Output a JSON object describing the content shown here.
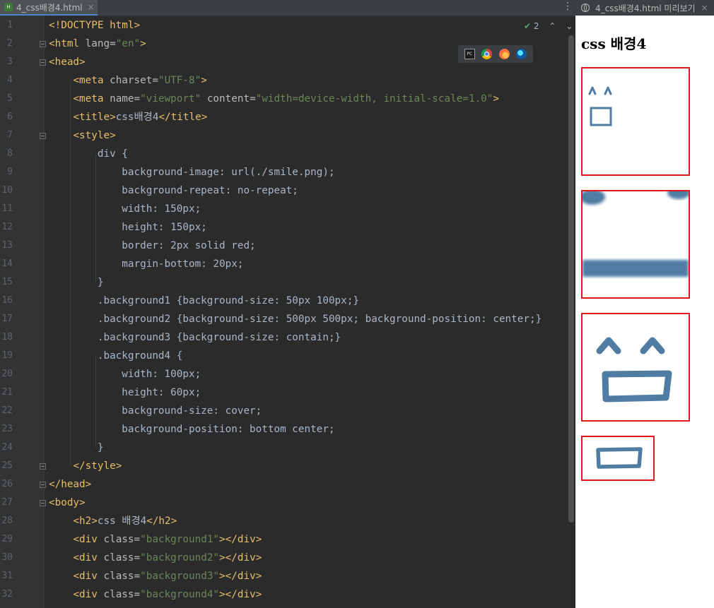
{
  "editor": {
    "tab_label": "4_css배경4.html",
    "tab_close": "×",
    "more_icon": "⋮",
    "inspection_count": "2",
    "check_icon": "check-icon",
    "browsers": [
      "pycharm-icon",
      "chrome-icon",
      "firefox-icon",
      "edge-icon"
    ],
    "line_numbers": [
      "1",
      "2",
      "3",
      "4",
      "5",
      "6",
      "7",
      "8",
      "9",
      "10",
      "11",
      "12",
      "13",
      "14",
      "15",
      "16",
      "17",
      "18",
      "19",
      "20",
      "21",
      "22",
      "23",
      "24",
      "25",
      "26",
      "27",
      "28",
      "29",
      "30",
      "31",
      "32"
    ],
    "lines": [
      [
        {
          "c": "tg",
          "t": "<!DOCTYPE html>"
        }
      ],
      [
        {
          "c": "tg",
          "t": "<html "
        },
        {
          "c": "at",
          "t": "lang="
        },
        {
          "c": "st",
          "t": "\"en\""
        },
        {
          "c": "tg",
          "t": ">"
        }
      ],
      [
        {
          "c": "tg",
          "t": "<head>"
        }
      ],
      [
        {
          "c": "pl",
          "t": "    "
        },
        {
          "c": "tg",
          "t": "<meta "
        },
        {
          "c": "at",
          "t": "charset="
        },
        {
          "c": "st",
          "t": "\"UTF-8\""
        },
        {
          "c": "tg",
          "t": ">"
        }
      ],
      [
        {
          "c": "pl",
          "t": "    "
        },
        {
          "c": "tg",
          "t": "<meta "
        },
        {
          "c": "at",
          "t": "name="
        },
        {
          "c": "st",
          "t": "\"viewport\""
        },
        {
          "c": "at",
          "t": " content="
        },
        {
          "c": "st",
          "t": "\"width=device-width, initial-scale=1.0\""
        },
        {
          "c": "tg",
          "t": ">"
        }
      ],
      [
        {
          "c": "pl",
          "t": "    "
        },
        {
          "c": "tg",
          "t": "<title>"
        },
        {
          "c": "pl",
          "t": "css배경4"
        },
        {
          "c": "tg",
          "t": "</title>"
        }
      ],
      [
        {
          "c": "pl",
          "t": "    "
        },
        {
          "c": "tg",
          "t": "<style>"
        }
      ],
      [
        {
          "c": "pl",
          "t": "        div {"
        }
      ],
      [
        {
          "c": "pl",
          "t": "            background-image: url(./smile.png);"
        }
      ],
      [
        {
          "c": "pl",
          "t": "            background-repeat: no-repeat;"
        }
      ],
      [
        {
          "c": "pl",
          "t": "            width: 150px;"
        }
      ],
      [
        {
          "c": "pl",
          "t": "            height: 150px;"
        }
      ],
      [
        {
          "c": "pl",
          "t": "            border: 2px solid red;"
        }
      ],
      [
        {
          "c": "pl",
          "t": "            margin-bottom: 20px;"
        }
      ],
      [
        {
          "c": "pl",
          "t": "        }"
        }
      ],
      [
        {
          "c": "pl",
          "t": "        .background1 {background-size: 50px 100px;}"
        }
      ],
      [
        {
          "c": "pl",
          "t": "        .background2 {background-size: 500px 500px; background-position: center;}"
        }
      ],
      [
        {
          "c": "pl",
          "t": "        .background3 {background-size: contain;}"
        }
      ],
      [
        {
          "c": "pl",
          "t": "        .background4 {"
        }
      ],
      [
        {
          "c": "pl",
          "t": "            width: 100px;"
        }
      ],
      [
        {
          "c": "pl",
          "t": "            height: 60px;"
        }
      ],
      [
        {
          "c": "pl",
          "t": "            background-size: cover;"
        }
      ],
      [
        {
          "c": "pl",
          "t": "            background-position: bottom center;"
        }
      ],
      [
        {
          "c": "pl",
          "t": "        }"
        }
      ],
      [
        {
          "c": "pl",
          "t": "    "
        },
        {
          "c": "tg",
          "t": "</style>"
        }
      ],
      [
        {
          "c": "tg",
          "t": "</head>"
        }
      ],
      [
        {
          "c": "tg",
          "t": "<body>"
        }
      ],
      [
        {
          "c": "pl",
          "t": "    "
        },
        {
          "c": "tg",
          "t": "<h2>"
        },
        {
          "c": "pl",
          "t": "css 배경4"
        },
        {
          "c": "tg",
          "t": "</h2>"
        }
      ],
      [
        {
          "c": "pl",
          "t": "    "
        },
        {
          "c": "tg",
          "t": "<div "
        },
        {
          "c": "at",
          "t": "class="
        },
        {
          "c": "st",
          "t": "\"background1\""
        },
        {
          "c": "tg",
          "t": "></div>"
        }
      ],
      [
        {
          "c": "pl",
          "t": "    "
        },
        {
          "c": "tg",
          "t": "<div "
        },
        {
          "c": "at",
          "t": "class="
        },
        {
          "c": "st",
          "t": "\"background2\""
        },
        {
          "c": "tg",
          "t": "></div>"
        }
      ],
      [
        {
          "c": "pl",
          "t": "    "
        },
        {
          "c": "tg",
          "t": "<div "
        },
        {
          "c": "at",
          "t": "class="
        },
        {
          "c": "st",
          "t": "\"background3\""
        },
        {
          "c": "tg",
          "t": "></div>"
        }
      ],
      [
        {
          "c": "pl",
          "t": "    "
        },
        {
          "c": "tg",
          "t": "<div "
        },
        {
          "c": "at",
          "t": "class="
        },
        {
          "c": "st",
          "t": "\"background4\""
        },
        {
          "c": "tg",
          "t": "></div>"
        }
      ]
    ]
  },
  "preview": {
    "tab_label": "4_css배경4.html 미리보기",
    "tab_close": "×",
    "heading": "css 배경4",
    "border_color": "#e0161c",
    "smile_color": "#4f7ca3"
  }
}
